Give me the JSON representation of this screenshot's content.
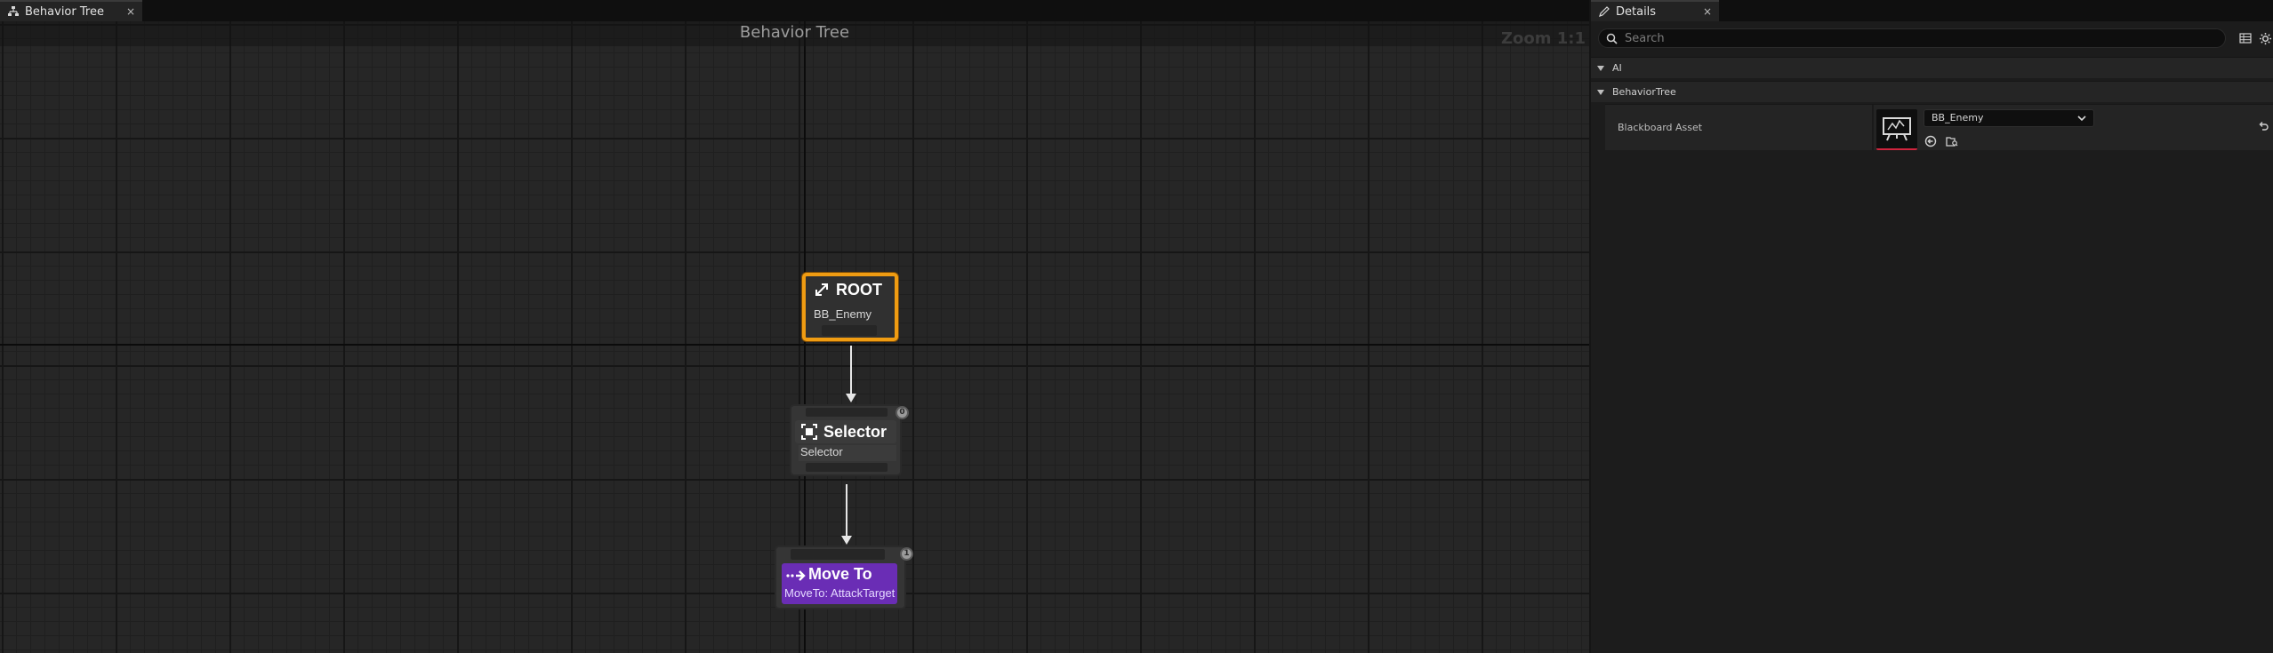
{
  "graph": {
    "tab_label": "Behavior Tree",
    "tab_close": "×",
    "title": "Behavior Tree",
    "zoom": "Zoom 1:1"
  },
  "nodes": {
    "root": {
      "title": "ROOT",
      "subtitle": "BB_Enemy",
      "icon": "root-icon",
      "border_color": "#f09c12"
    },
    "selector": {
      "title": "Selector",
      "subtitle": "Selector",
      "icon": "selector-icon",
      "badge": "0"
    },
    "move_to": {
      "title": "Move To",
      "subtitle": "MoveTo: AttackTarget",
      "icon": "move-to-icon",
      "badge": "1",
      "title_color": "#6a2db5"
    }
  },
  "details": {
    "tab_label": "Details",
    "tab_close": "×",
    "search_placeholder": "Search",
    "categories": [
      {
        "label": "AI"
      },
      {
        "label": "BehaviorTree"
      }
    ],
    "property": {
      "name": "Blackboard Asset",
      "value": "BB_Enemy",
      "accent": "#d0243e"
    }
  }
}
